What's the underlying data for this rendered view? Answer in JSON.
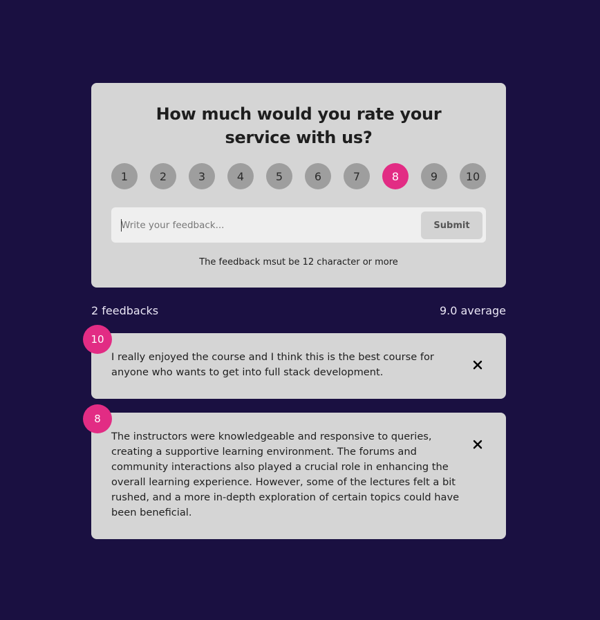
{
  "form": {
    "title": "How much would you rate your service with us?",
    "ratings": [
      "1",
      "2",
      "3",
      "4",
      "5",
      "6",
      "7",
      "8",
      "9",
      "10"
    ],
    "selected_rating": "8",
    "input_placeholder": "Write your feedback...",
    "input_value": "",
    "submit_label": "Submit",
    "validation_message": "The feedback msut be 12 character or more"
  },
  "stats": {
    "count_label": "2 feedbacks",
    "average_label": "9.0 average"
  },
  "feedbacks": [
    {
      "rating": "10",
      "text": "I really enjoyed the course and I think this is the best course for anyone who wants to get into full stack development."
    },
    {
      "rating": "8",
      "text": "The instructors were knowledgeable and responsive to queries, creating a supportive learning environment. The forums and community interactions also played a crucial role in enhancing the overall learning experience. However, some of the lectures felt a bit rushed, and a more in-depth exploration of certain topics could have been beneficial."
    }
  ],
  "colors": {
    "background": "#1a1041",
    "card": "#d5d5d5",
    "accent": "#e22c84",
    "option": "#9e9e9e"
  },
  "icons": {
    "delete": "close-icon"
  }
}
